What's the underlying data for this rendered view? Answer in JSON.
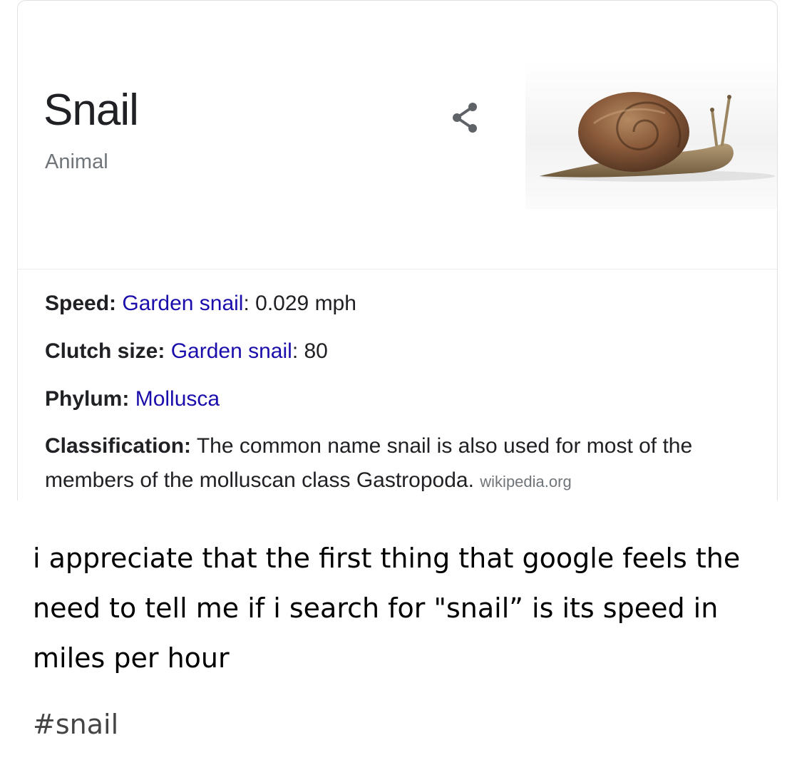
{
  "knowledge_panel": {
    "title": "Snail",
    "subtitle": "Animal",
    "share_icon": "share-icon",
    "image_icon": "snail-photo",
    "facts": [
      {
        "label": "Speed:",
        "link": "Garden snail",
        "value": ": 0.029 mph"
      },
      {
        "label": "Clutch size:",
        "link": "Garden snail",
        "value": ": 80"
      },
      {
        "label": "Phylum:",
        "link": "Mollusca",
        "value": ""
      },
      {
        "label": "Classification:",
        "text": " The common name snail is also used for most of the members of the molluscan class Gastropoda. ",
        "source": "wikipedia.org"
      }
    ]
  },
  "post": {
    "caption": "i appreciate that the first thing that google feels the need to tell me if i search for \"snail” is its speed in miles per hour",
    "tag": "#snail"
  },
  "colors": {
    "link": "#1a0dab",
    "title": "#202124",
    "subtitle": "#70757a",
    "border": "#dfe1e5"
  }
}
